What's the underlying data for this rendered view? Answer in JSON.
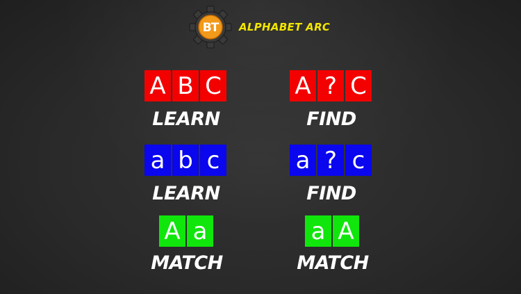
{
  "app": {
    "logo_text": "BT",
    "title": "ALPHABET ARC"
  },
  "colors": {
    "red": "#f30000",
    "blue": "#0a06ee",
    "green": "#10e60c",
    "title_yellow": "#f2e600",
    "logo_orange": "#f29a1a",
    "background": "#2b2b2b"
  },
  "menu": {
    "learn_upper": {
      "tiles": [
        "A",
        "B",
        "C"
      ],
      "label": "LEARN"
    },
    "find_upper": {
      "tiles": [
        "A",
        "?",
        "C"
      ],
      "label": "FIND"
    },
    "learn_lower": {
      "tiles": [
        "a",
        "b",
        "c"
      ],
      "label": "LEARN"
    },
    "find_lower": {
      "tiles": [
        "a",
        "?",
        "c"
      ],
      "label": "FIND"
    },
    "match_left": {
      "tiles": [
        "A",
        "a"
      ],
      "label": "MATCH"
    },
    "match_right": {
      "tiles": [
        "a",
        "A"
      ],
      "label": "MATCH"
    }
  }
}
